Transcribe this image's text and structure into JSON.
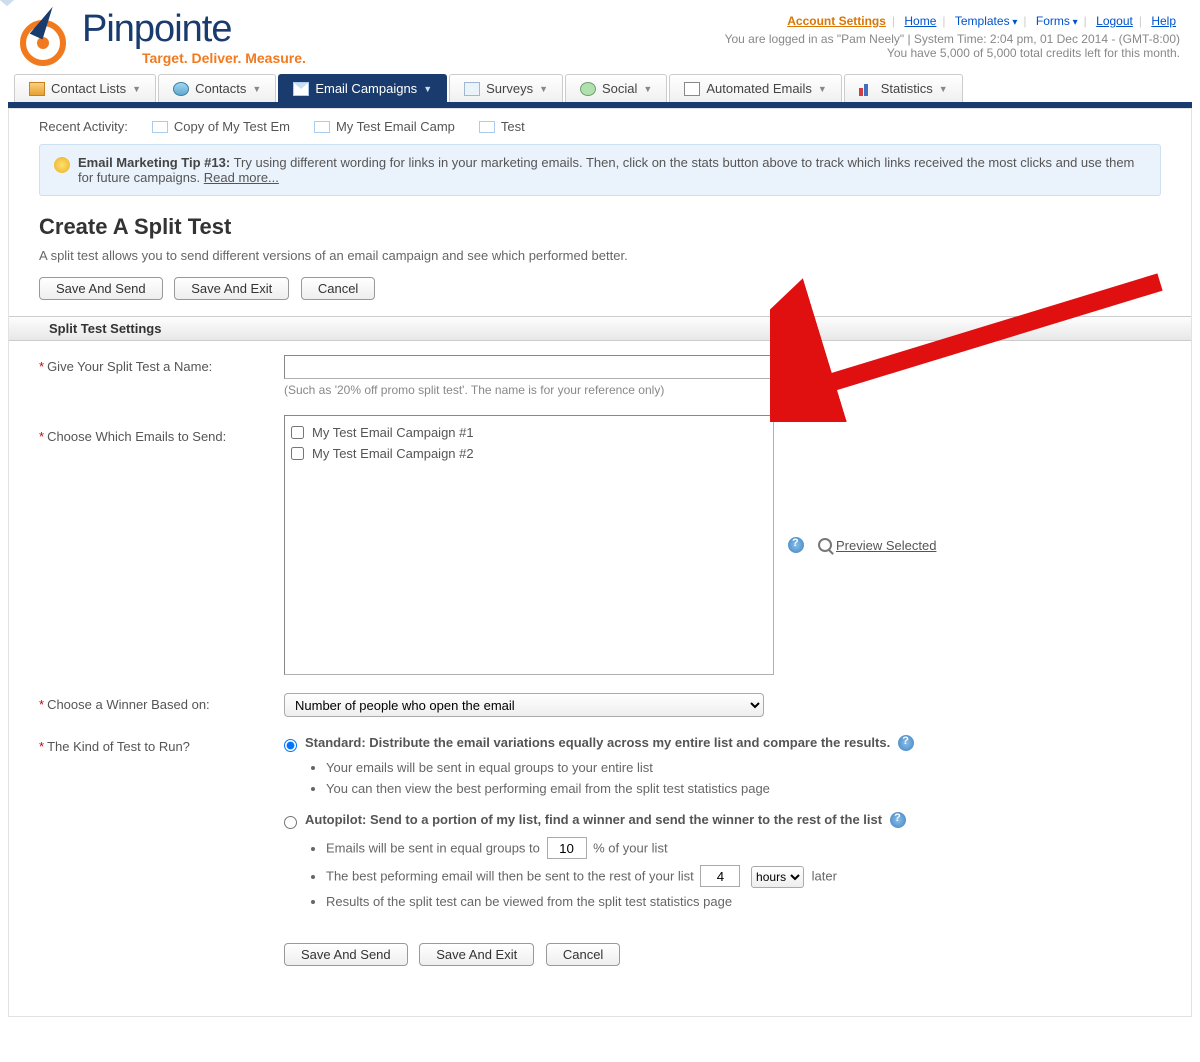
{
  "header": {
    "logo_name": "Pinpointe",
    "logo_tag": "Target. Deliver. Measure.",
    "links": {
      "account": "Account Settings",
      "home": "Home",
      "templates": "Templates",
      "forms": "Forms",
      "logout": "Logout",
      "help": "Help"
    },
    "status1": "You are logged in as \"Pam Neely\" | System Time: 2:04 pm, 01 Dec 2014 - (GMT-8:00)",
    "status2": "You have 5,000 of 5,000 total credits left for this month."
  },
  "nav": {
    "contact_lists": "Contact Lists",
    "contacts": "Contacts",
    "email_campaigns": "Email Campaigns",
    "surveys": "Surveys",
    "social": "Social",
    "automated": "Automated Emails",
    "statistics": "Statistics"
  },
  "recent": {
    "label": "Recent Activity:",
    "items": [
      "Copy of My Test Em",
      "My Test Email Camp",
      "Test"
    ]
  },
  "tip": {
    "title": "Email Marketing Tip #13:",
    "body": "Try using different wording for links in your marketing emails. Then, click on the stats button above to track which links received the most clicks and use them for future campaigns.",
    "read": "Read more..."
  },
  "page": {
    "title": "Create A Split Test",
    "desc": "A split test allows you to send different versions of an email campaign and see which performed better.",
    "save_send": "Save And Send",
    "save_exit": "Save And Exit",
    "cancel": "Cancel",
    "section": "Split Test Settings",
    "name_label": "Give Your Split Test a Name:",
    "name_hint": "(Such as '20% off promo split test'. The name is for your reference only)",
    "choose_label": "Choose Which Emails to Send:",
    "emails": [
      "My Test Email Campaign #1",
      "My Test Email Campaign #2"
    ],
    "preview": "Preview Selected",
    "winner_label": "Choose a Winner Based on:",
    "winner_option": "Number of people who open the email",
    "kind_label": "The Kind of Test to Run?",
    "standard_label": "Standard: Distribute the email variations equally across my entire list and compare the results.",
    "standard_b1": "Your emails will be sent in equal groups to your entire list",
    "standard_b2": "You can then view the best performing email from the split test statistics page",
    "auto_label": "Autopilot: Send to a portion of my list, find a winner and send the winner to the rest of the list",
    "auto_b1_pre": "Emails will be sent in equal groups to",
    "auto_b1_val": "10",
    "auto_b1_post": "% of your list",
    "auto_b2_pre": "The best peforming email will then be sent to the rest of your list",
    "auto_b2_val": "4",
    "auto_b2_unit": "hours",
    "auto_b2_post": "later",
    "auto_b3": "Results of the split test can be viewed from the split test statistics page"
  }
}
